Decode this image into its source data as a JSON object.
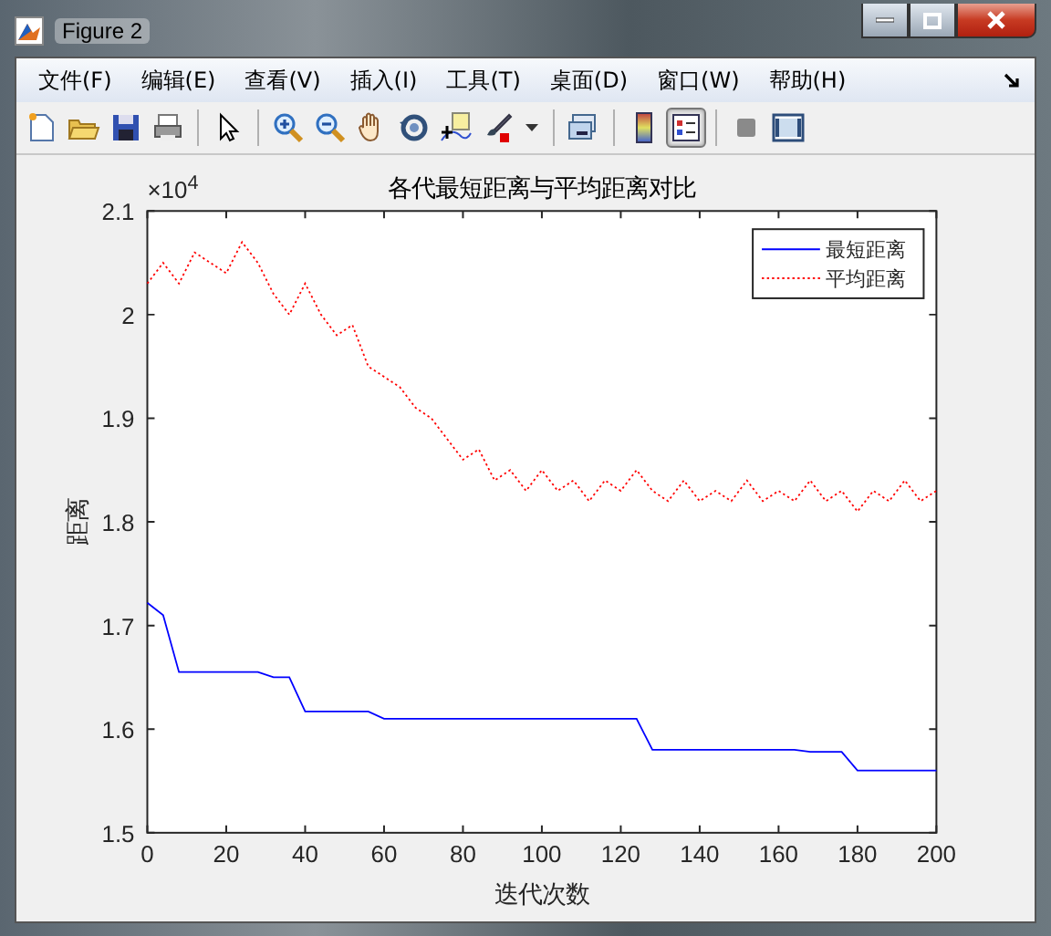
{
  "window": {
    "title": "Figure 2"
  },
  "menu": [
    {
      "label": "文件(F)"
    },
    {
      "label": "编辑(E)"
    },
    {
      "label": "查看(V)"
    },
    {
      "label": "插入(I)"
    },
    {
      "label": "工具(T)"
    },
    {
      "label": "桌面(D)"
    },
    {
      "label": "窗口(W)"
    },
    {
      "label": "帮助(H)"
    }
  ],
  "toolbar": [
    {
      "kind": "new",
      "pressed": false
    },
    {
      "kind": "open",
      "pressed": false
    },
    {
      "kind": "save",
      "pressed": false
    },
    {
      "kind": "print",
      "pressed": false
    },
    {
      "kind": "separator"
    },
    {
      "kind": "pointer",
      "pressed": false
    },
    {
      "kind": "separator"
    },
    {
      "kind": "zoom-in",
      "pressed": false
    },
    {
      "kind": "zoom-out",
      "pressed": false
    },
    {
      "kind": "pan",
      "pressed": false
    },
    {
      "kind": "rotate",
      "pressed": false
    },
    {
      "kind": "data-cursor",
      "pressed": false
    },
    {
      "kind": "brush",
      "pressed": false
    },
    {
      "kind": "caret"
    },
    {
      "kind": "separator"
    },
    {
      "kind": "link",
      "pressed": false
    },
    {
      "kind": "separator"
    },
    {
      "kind": "colorbar",
      "pressed": false
    },
    {
      "kind": "legend",
      "pressed": true
    },
    {
      "kind": "separator"
    },
    {
      "kind": "hide-tools",
      "pressed": false
    },
    {
      "kind": "show-tools",
      "pressed": false
    }
  ],
  "chart_data": {
    "type": "line",
    "title": "各代最短距离与平均距离对比",
    "xlabel": "迭代次数",
    "ylabel": "距离",
    "annotations": [
      "×10$^{4}$"
    ],
    "x": [
      0,
      4,
      8,
      12,
      16,
      20,
      24,
      28,
      32,
      36,
      40,
      44,
      48,
      52,
      56,
      60,
      64,
      68,
      72,
      76,
      80,
      84,
      88,
      92,
      96,
      100,
      104,
      108,
      112,
      116,
      120,
      124,
      128,
      132,
      136,
      140,
      144,
      148,
      152,
      156,
      160,
      164,
      168,
      172,
      176,
      180,
      184,
      188,
      192,
      196,
      200
    ],
    "series": [
      {
        "name": "最短距离",
        "color": "#0000ff",
        "line_style": "solid",
        "values": [
          1.722,
          1.71,
          1.655,
          1.655,
          1.655,
          1.655,
          1.655,
          1.655,
          1.65,
          1.65,
          1.617,
          1.617,
          1.617,
          1.617,
          1.617,
          1.61,
          1.61,
          1.61,
          1.61,
          1.61,
          1.61,
          1.61,
          1.61,
          1.61,
          1.61,
          1.61,
          1.61,
          1.61,
          1.61,
          1.61,
          1.61,
          1.61,
          1.58,
          1.58,
          1.58,
          1.58,
          1.58,
          1.58,
          1.58,
          1.58,
          1.58,
          1.58,
          1.578,
          1.578,
          1.578,
          1.56,
          1.56,
          1.56,
          1.56,
          1.56,
          1.56
        ]
      },
      {
        "name": "平均距离",
        "color": "#ff0000",
        "line_style": "dotted",
        "values": [
          2.03,
          2.05,
          2.03,
          2.06,
          2.05,
          2.04,
          2.07,
          2.05,
          2.02,
          2.0,
          2.03,
          2.0,
          1.98,
          1.99,
          1.95,
          1.94,
          1.93,
          1.91,
          1.9,
          1.88,
          1.86,
          1.87,
          1.84,
          1.85,
          1.83,
          1.85,
          1.83,
          1.84,
          1.82,
          1.84,
          1.83,
          1.85,
          1.83,
          1.82,
          1.84,
          1.82,
          1.83,
          1.82,
          1.84,
          1.82,
          1.83,
          1.82,
          1.84,
          1.82,
          1.83,
          1.81,
          1.83,
          1.82,
          1.84,
          1.82,
          1.83
        ]
      }
    ],
    "legend": true,
    "xlim": [
      0,
      200
    ],
    "ylim": [
      1.5,
      2.1
    ],
    "xticks": [
      0,
      20,
      40,
      60,
      80,
      100,
      120,
      140,
      160,
      180,
      200
    ],
    "yticks": [
      {
        "value": 1.5,
        "label": "1.5"
      },
      {
        "value": 1.6,
        "label": "1.6"
      },
      {
        "value": 1.7,
        "label": "1.7"
      },
      {
        "value": 1.8,
        "label": "1.8"
      },
      {
        "value": 1.9,
        "label": "1.9"
      },
      {
        "value": 2.0,
        "label": "2"
      },
      {
        "value": 2.1,
        "label": "2.1"
      }
    ]
  }
}
